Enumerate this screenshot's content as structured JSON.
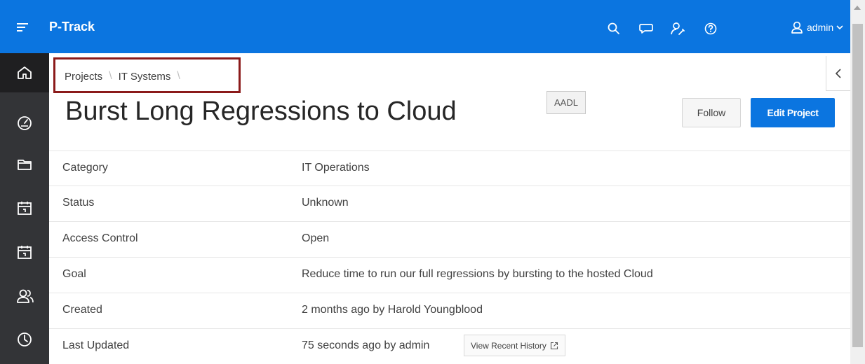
{
  "app": {
    "title": "P-Track"
  },
  "user": {
    "name": "admin"
  },
  "breadcrumb": {
    "items": [
      "Projects",
      "IT Systems"
    ],
    "separator": "\\"
  },
  "project": {
    "title": "Burst Long Regressions to Cloud",
    "badge": "AADL"
  },
  "actions": {
    "follow_label": "Follow",
    "edit_label": "Edit Project"
  },
  "details": [
    {
      "label": "Category",
      "value": "IT Operations"
    },
    {
      "label": "Status",
      "value": "Unknown"
    },
    {
      "label": "Access Control",
      "value": "Open"
    },
    {
      "label": "Goal",
      "value": "Reduce time to run our full regressions by bursting to the hosted Cloud"
    },
    {
      "label": "Created",
      "value": "2 months ago by Harold Youngblood"
    },
    {
      "label": "Last Updated",
      "value": "75 seconds ago by admin"
    }
  ],
  "history_button": {
    "label": "View Recent History"
  },
  "nav": [
    "home-icon",
    "dashboard-icon",
    "folder-icon",
    "calendar-icon",
    "calendar-icon",
    "people-icon",
    "clock-icon"
  ],
  "colors": {
    "header": "#0b75e0",
    "sidebar": "#333437",
    "accent": "#0b75e0",
    "highlight": "#8b1a1a"
  }
}
